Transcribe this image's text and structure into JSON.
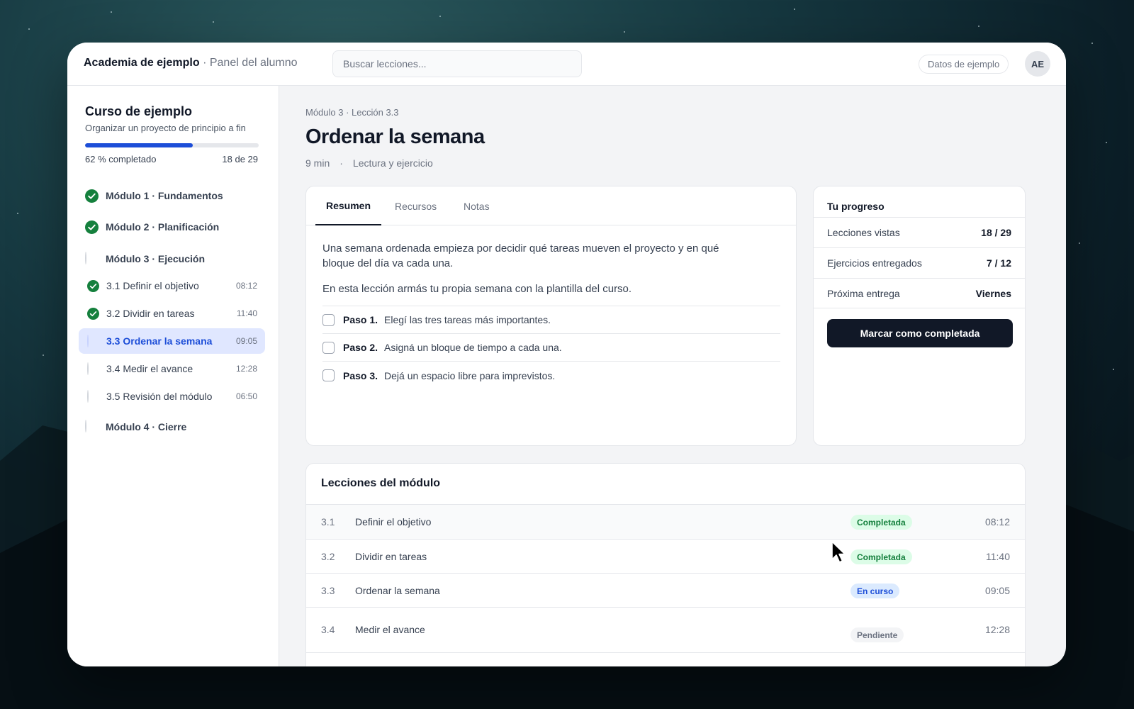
{
  "header": {
    "app_name": "Academia de ejemplo",
    "section": "· Panel del alumno",
    "search_placeholder": "Buscar lecciones...",
    "sample_data_label": "Datos de ejemplo",
    "avatar_initials": "AE"
  },
  "sidebar": {
    "course_title": "Curso de ejemplo",
    "course_subtitle": "Organizar un proyecto de principio a fin",
    "progress_fraction": 0.62,
    "progress_label": "62 % completado",
    "progress_count": "18 de 29",
    "modules": [
      {
        "label": "Módulo 1 · Fundamentos",
        "status": "complete"
      },
      {
        "label": "Módulo 2 · Planificación",
        "status": "complete"
      },
      {
        "label": "Módulo 3 · Ejecución",
        "status": "open"
      },
      {
        "label": "Módulo 4 · Cierre",
        "status": "open"
      }
    ],
    "lessons": [
      {
        "label": "3.1 Definir el objetivo",
        "duration": "08:12",
        "status": "complete"
      },
      {
        "label": "3.2 Dividir en tareas",
        "duration": "11:40",
        "status": "complete"
      },
      {
        "label": "3.3 Ordenar la semana",
        "duration": "09:05",
        "status": "active"
      },
      {
        "label": "3.4 Medir el avance",
        "duration": "12:28",
        "status": "open"
      },
      {
        "label": "3.5 Revisión del módulo",
        "duration": "06:50",
        "status": "open"
      }
    ]
  },
  "main": {
    "breadcrumb": "Módulo 3 · Lección 3.3",
    "title": "Ordenar la semana",
    "duration": "9 min",
    "separator": "·",
    "type": "Lectura y ejercicio",
    "tabs": [
      "Resumen",
      "Recursos",
      "Notas"
    ],
    "paragraph1": "Una semana ordenada empieza por decidir qué tareas mueven el proyecto y en qué bloque del día va cada una.",
    "paragraph2": "En esta lección armás tu propia semana con la plantilla del curso.",
    "steps": [
      {
        "num": "Paso 1.",
        "text": "Elegí las tres tareas más importantes."
      },
      {
        "num": "Paso 2.",
        "text": "Asigná un bloque de tiempo a cada una."
      },
      {
        "num": "Paso 3.",
        "text": "Dejá un espacio libre para imprevistos."
      }
    ]
  },
  "progress_card": {
    "title": "Tu progreso",
    "rows": [
      {
        "label": "Lecciones vistas",
        "value": "18 / 29"
      },
      {
        "label": "Ejercicios entregados",
        "value": "7 / 12"
      },
      {
        "label": "Próxima entrega",
        "value": "Viernes"
      }
    ],
    "button": "Marcar como completada"
  },
  "module_lessons": {
    "title": "Lecciones del módulo",
    "rows": [
      {
        "num": "3.1",
        "title": "Definir el objetivo",
        "status": "Completada",
        "kind": "done",
        "duration": "08:12"
      },
      {
        "num": "3.2",
        "title": "Dividir en tareas",
        "status": "Completada",
        "kind": "done",
        "duration": "11:40"
      },
      {
        "num": "3.3",
        "title": "Ordenar la semana",
        "status": "En curso",
        "kind": "progress",
        "duration": "09:05"
      },
      {
        "num": "3.4",
        "title": "Medir el avance",
        "status": "Pendiente",
        "kind": "pending",
        "duration": "12:28"
      }
    ]
  },
  "colors": {
    "accent": "#1d4ed8",
    "success": "#15803d",
    "primary_button": "#111827"
  }
}
